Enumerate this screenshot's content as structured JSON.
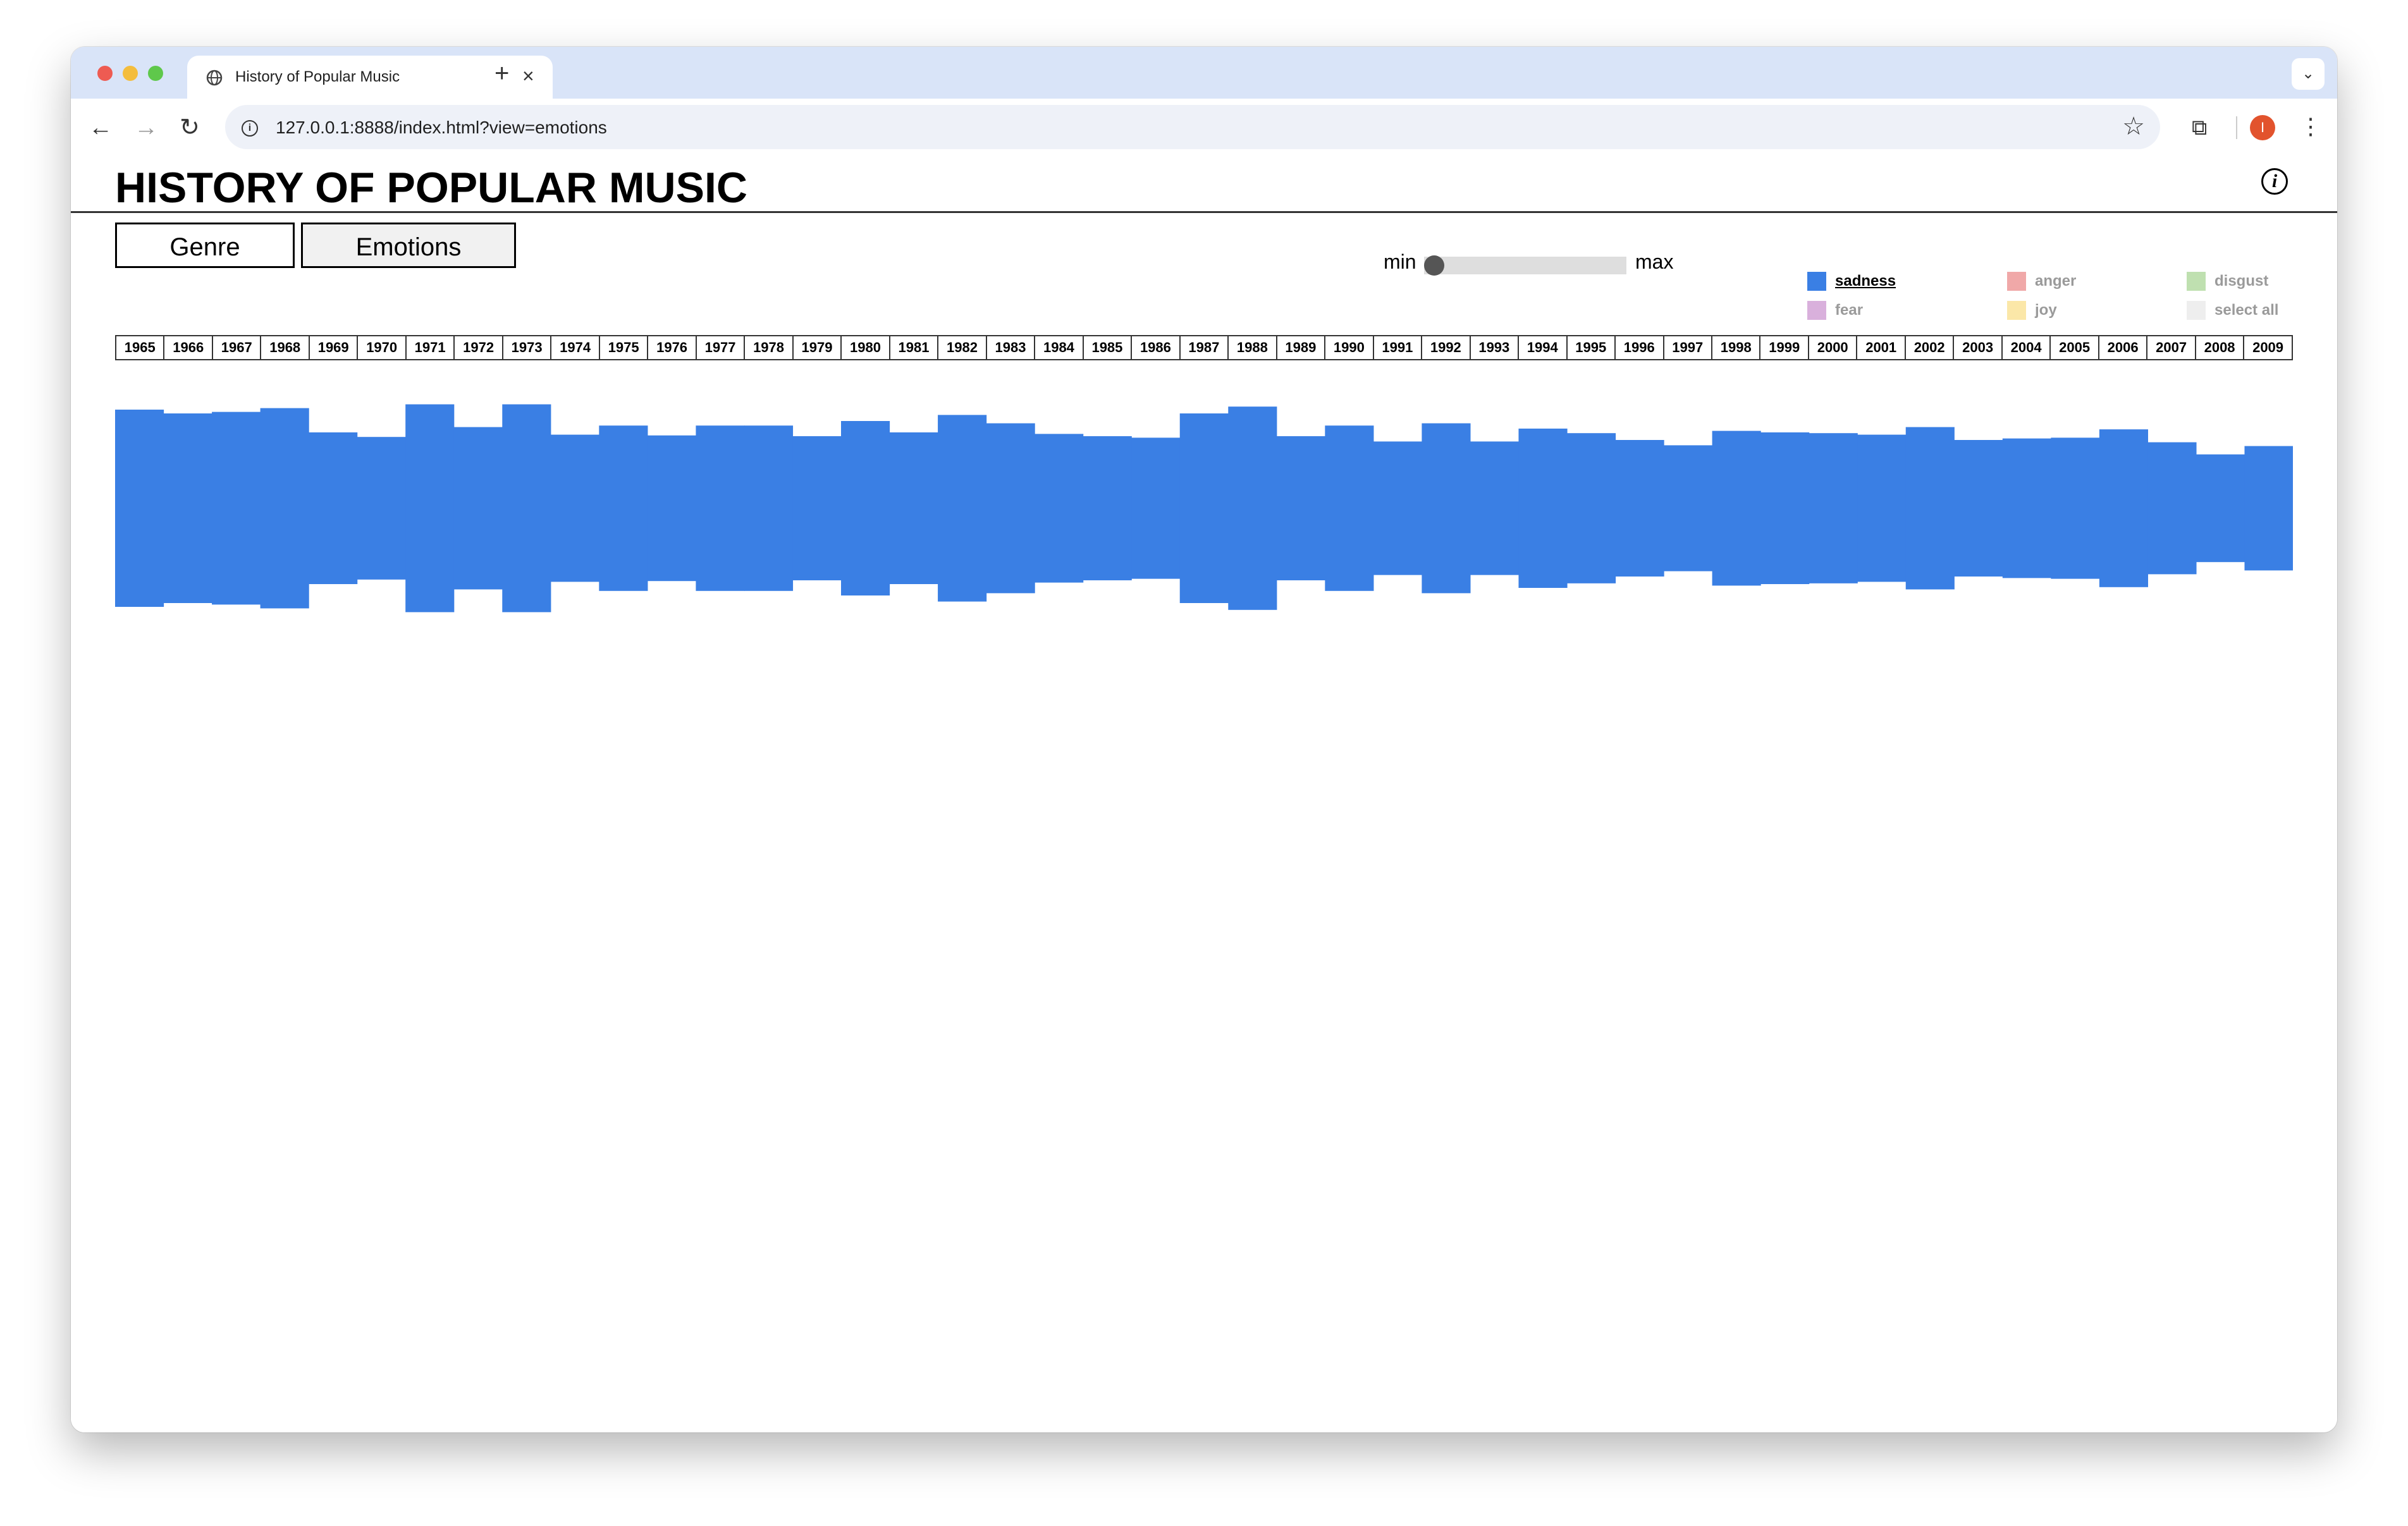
{
  "browser": {
    "tab_title": "History of Popular Music",
    "url": "127.0.0.1:8888/index.html?view=emotions",
    "avatar_letter": "I"
  },
  "page": {
    "title": "HISTORY OF POPULAR MUSIC",
    "buttons": {
      "genre": "Genre",
      "emotions": "Emotions"
    },
    "slider": {
      "min_label": "min",
      "max_label": "max",
      "value": 0
    },
    "legend": [
      {
        "label": "sadness",
        "color": "#3a7fe4",
        "active": true
      },
      {
        "label": "anger",
        "color": "#f0a8a8",
        "active": false
      },
      {
        "label": "disgust",
        "color": "#bfe0b0",
        "active": false
      },
      {
        "label": "fear",
        "color": "#d9b0dc",
        "active": false
      },
      {
        "label": "joy",
        "color": "#fbe7a8",
        "active": false
      },
      {
        "label": "select all",
        "color": "#eeeeee",
        "active": false
      }
    ]
  },
  "chart_data": {
    "type": "area",
    "series": [
      {
        "name": "sadness",
        "color": "#3a7fe4",
        "x": [
          1965,
          1966,
          1967,
          1968,
          1969,
          1970,
          1971,
          1972,
          1973,
          1974,
          1975,
          1976,
          1977,
          1978,
          1979,
          1980,
          1981,
          1982,
          1983,
          1984,
          1985,
          1986,
          1987,
          1988,
          1989,
          1990,
          1991,
          1992,
          1993,
          1994,
          1995,
          1996,
          1997,
          1998,
          1999,
          2000,
          2001,
          2002,
          2003,
          2004,
          2005,
          2006,
          2007,
          2008,
          2009
        ],
        "values": [
          130,
          125,
          127,
          132,
          100,
          94,
          137,
          107,
          137,
          97,
          109,
          96,
          109,
          109,
          95,
          115,
          100,
          123,
          112,
          98,
          95,
          93,
          125,
          134,
          95,
          109,
          88,
          112,
          88,
          105,
          99,
          90,
          83,
          102,
          100,
          99,
          97,
          107,
          90,
          92,
          93,
          104,
          87,
          71,
          82
        ]
      }
    ],
    "categories": [
      "1965",
      "1966",
      "1967",
      "1968",
      "1969",
      "1970",
      "1971",
      "1972",
      "1973",
      "1974",
      "1975",
      "1976",
      "1977",
      "1978",
      "1979",
      "1980",
      "1981",
      "1982",
      "1983",
      "1984",
      "1985",
      "1986",
      "1987",
      "1988",
      "1989",
      "1990",
      "1991",
      "1992",
      "1993",
      "1994",
      "1995",
      "1996",
      "1997",
      "1998",
      "1999",
      "2000",
      "2001",
      "2002",
      "2003",
      "2004",
      "2005",
      "2006",
      "2007",
      "2008",
      "2009"
    ]
  }
}
